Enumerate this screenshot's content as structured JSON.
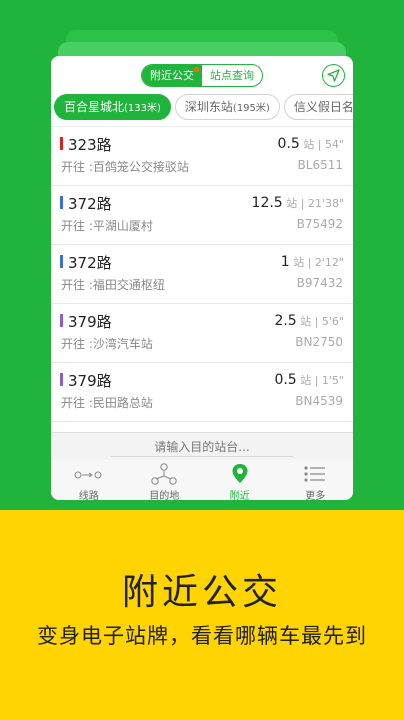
{
  "top_seg": {
    "nearby": "附近公交",
    "stop_query": "站点查询"
  },
  "stop_tabs": [
    {
      "name": "百合星城北",
      "dist": "(133米)"
    },
    {
      "name": "深圳东站",
      "dist": "(195米)"
    },
    {
      "name": "信义假日名城(",
      "dist": ""
    }
  ],
  "routes": [
    {
      "name": "323路",
      "dest": "开往 :百鸽笼公交接驳站",
      "stops": "0.5",
      "unit": "站",
      "time": "54\"",
      "plate": "BL6511",
      "color": "#e02020"
    },
    {
      "name": "372路",
      "dest": "开往 :平湖山厦村",
      "stops": "12.5",
      "unit": "站",
      "time": "21'38\"",
      "plate": "B75492",
      "color": "#3a6ed8"
    },
    {
      "name": "372路",
      "dest": "开往 :福田交通枢纽",
      "stops": "1",
      "unit": "站",
      "time": "2'12\"",
      "plate": "B97432",
      "color": "#3a6ed8"
    },
    {
      "name": "379路",
      "dest": "开往 :沙湾汽车站",
      "stops": "2.5",
      "unit": "站",
      "time": "5'6\"",
      "plate": "BN2750",
      "color": "#8a5cd8"
    },
    {
      "name": "379路",
      "dest": "开往 :民田路总站",
      "stops": "0.5",
      "unit": "站",
      "time": "1'5\"",
      "plate": "BN4539",
      "color": "#8a5cd8"
    }
  ],
  "search": {
    "placeholder": "请输入目的站台..."
  },
  "nav": {
    "route": "线路",
    "destination": "目的地",
    "nearby": "附近",
    "more": "更多"
  },
  "promo": {
    "headline": "附近公交",
    "subline": "变身电子站牌，看看哪辆车最先到"
  },
  "colors": {
    "green": "#20b43c",
    "yellow": "#ffd400"
  }
}
